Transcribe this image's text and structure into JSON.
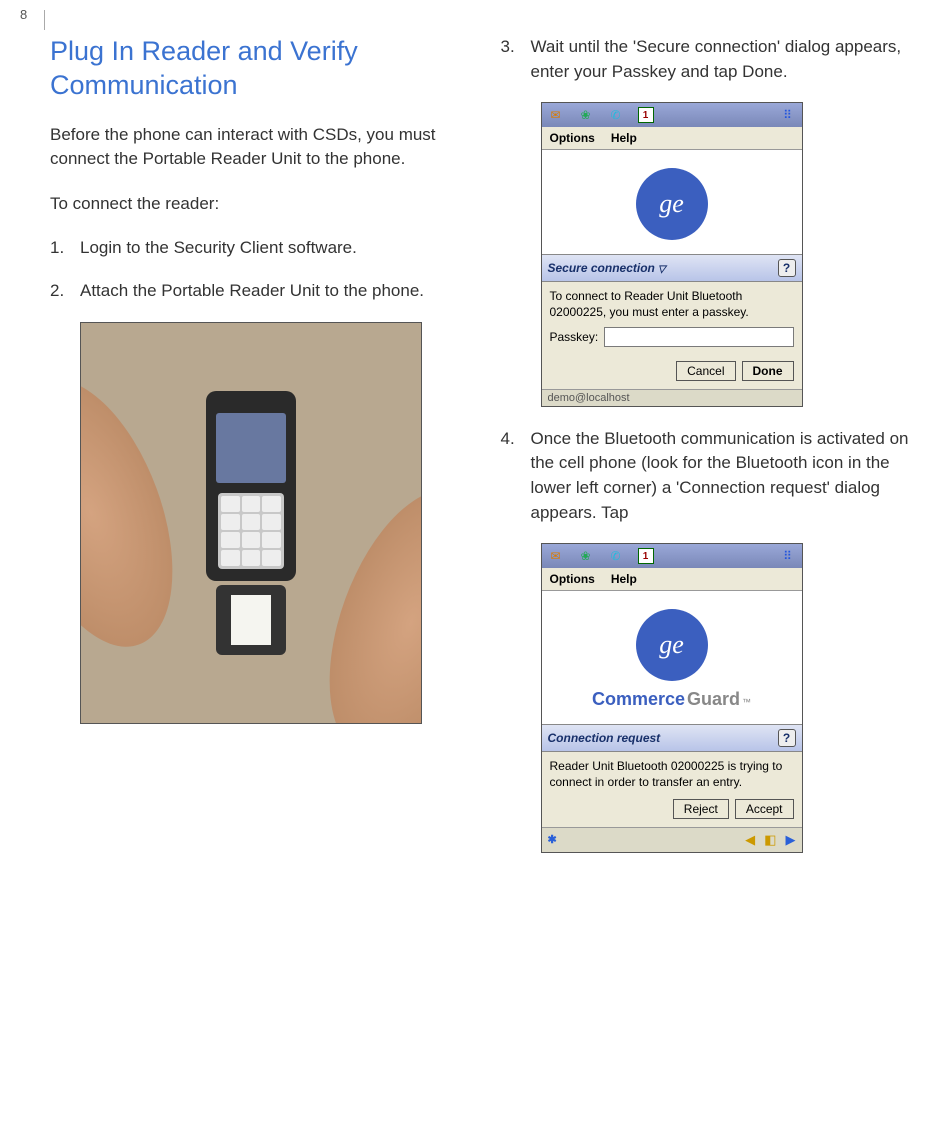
{
  "page_number": "8",
  "section_title": "Plug In Reader and Verify Communication",
  "intro": "Before the phone can interact with CSDs, you must connect the Portable Reader Unit to the phone.",
  "connect_label": "To connect the reader:",
  "steps": {
    "s1_num": "1.",
    "s1": "Login to the Security Client software.",
    "s2_num": "2.",
    "s2": "Attach the Portable Reader Unit to the phone.",
    "s3_num": "3.",
    "s3": "Wait until the 'Secure connection' dialog appears, enter your Passkey and tap Done.",
    "s4_num": "4.",
    "s4": "Once the Bluetooth communication is activated on the cell phone (look for the Bluetooth icon in the lower left corner) a 'Connection request' dialog appears. Tap"
  },
  "screenshot_a": {
    "menu_options": "Options",
    "menu_help": "Help",
    "logo_text": "ge",
    "dialog_title": "Secure connection",
    "help_icon": "?",
    "body_text": "To connect to Reader Unit Bluetooth 02000225, you must enter a passkey.",
    "passkey_label": "Passkey:",
    "btn_cancel": "Cancel",
    "btn_done": "Done",
    "status": "demo@localhost"
  },
  "screenshot_b": {
    "menu_options": "Options",
    "menu_help": "Help",
    "logo_text": "ge",
    "brand_blue": "Commerce",
    "brand_grey": "Guard",
    "brand_tm": "™",
    "dialog_title": "Connection request",
    "help_icon": "?",
    "body_text": "Reader Unit Bluetooth 02000225 is trying to connect in order to transfer an entry.",
    "btn_reject": "Reject",
    "btn_accept": "Accept",
    "bt_icon": "✱"
  },
  "icons": {
    "mail": "✉",
    "globe": "❀",
    "phone": "✆",
    "cal": "1",
    "grid": "⠿",
    "speaker": "◀",
    "note": "◧",
    "tri": "▶"
  }
}
